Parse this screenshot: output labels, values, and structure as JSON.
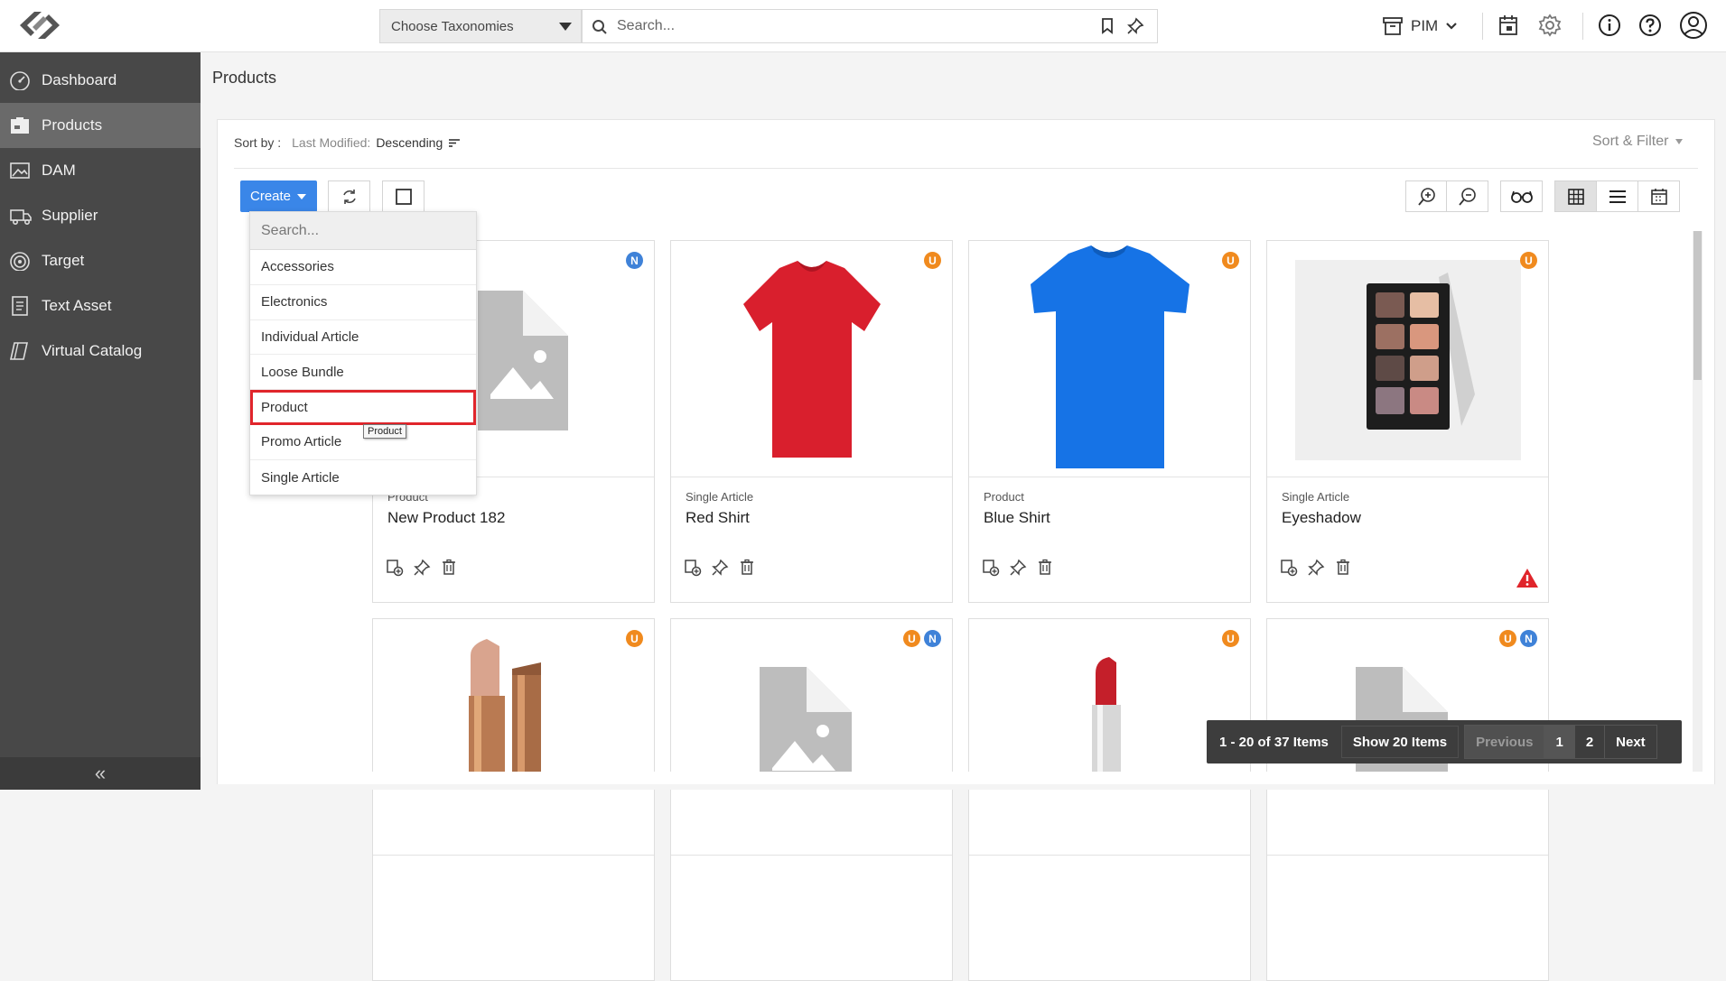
{
  "header": {
    "taxonomy_placeholder": "Choose Taxonomies",
    "search_placeholder": "Search...",
    "workspace": "PIM"
  },
  "sidebar": {
    "items": [
      {
        "label": "Dashboard",
        "icon": "speedometer-icon"
      },
      {
        "label": "Products",
        "icon": "box-icon",
        "active": true
      },
      {
        "label": "DAM",
        "icon": "image-icon"
      },
      {
        "label": "Supplier",
        "icon": "truck-icon"
      },
      {
        "label": "Target",
        "icon": "target-icon"
      },
      {
        "label": "Text Asset",
        "icon": "document-icon"
      },
      {
        "label": "Virtual Catalog",
        "icon": "catalog-icon"
      }
    ],
    "collapse_label": "«"
  },
  "main": {
    "title": "Products",
    "sort_label": "Sort by :",
    "sort_field": "Last Modified:",
    "sort_order": "Descending",
    "sort_filter_label": "Sort & Filter",
    "create_label": "Create"
  },
  "create_menu": {
    "search_placeholder": "Search...",
    "items": [
      "Accessories",
      "Electronics",
      "Individual Article",
      "Loose Bundle",
      "Product",
      "Promo Article",
      "Single Article"
    ],
    "highlighted": "Product",
    "tooltip": "Product"
  },
  "cards": [
    {
      "type": "Product",
      "title": "New Product 182",
      "badges": [
        "N"
      ],
      "image": "placeholder-icon"
    },
    {
      "type": "Single Article",
      "title": "Red Shirt",
      "badges": [
        "U"
      ],
      "image": "red-tshirt"
    },
    {
      "type": "Product",
      "title": "Blue Shirt",
      "badges": [
        "U"
      ],
      "image": "blue-tshirt"
    },
    {
      "type": "Single Article",
      "title": "Eyeshadow",
      "badges": [
        "U"
      ],
      "image": "eyeshadow-palette",
      "warning": true
    },
    {
      "type": "",
      "title": "",
      "badges": [
        "U"
      ],
      "image": "nude-lipstick"
    },
    {
      "type": "",
      "title": "",
      "badges": [
        "U",
        "N"
      ],
      "image": "placeholder-icon"
    },
    {
      "type": "",
      "title": "",
      "badges": [
        "U"
      ],
      "image": "red-lipstick"
    },
    {
      "type": "",
      "title": "",
      "badges": [
        "U",
        "N"
      ],
      "image": "placeholder-icon"
    }
  ],
  "pagination": {
    "info": "1 - 20 of 37 Items",
    "page_size": "Show 20 Items",
    "previous": "Previous",
    "pages": [
      "1",
      "2"
    ],
    "current_page": "1",
    "next": "Next"
  },
  "colors": {
    "accent": "#3a86e8",
    "sidebar_bg": "#484848",
    "badge_u": "#f08a1e",
    "badge_n": "#3f82d8",
    "highlight": "#e0252b"
  }
}
